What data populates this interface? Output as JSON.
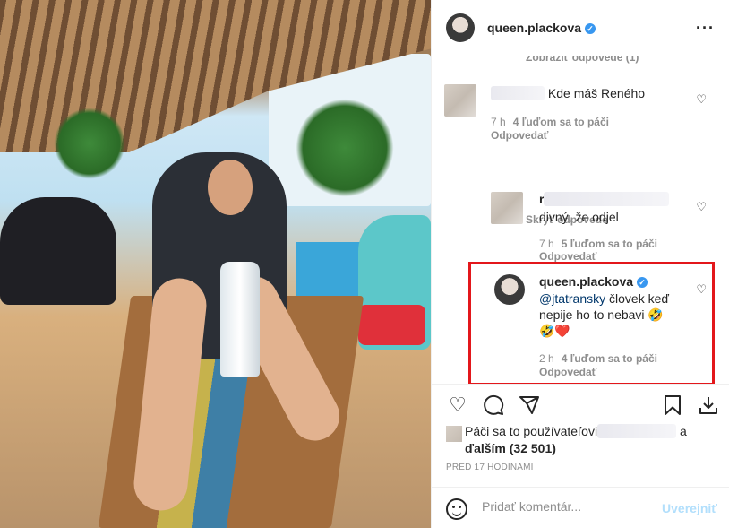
{
  "post": {
    "username": "queen.plackova",
    "more_icon": "more-icon"
  },
  "comments": {
    "truncated_label": "Zobraziť odpovede (1)",
    "hide_replies": "Skryť odpovede",
    "items": [
      {
        "text": "Kde máš Reného",
        "time": "7 h",
        "likes": "4 ľuďom sa to páči",
        "reply": "Odpovedať"
      },
      {
        "text": "divný, že odjel",
        "time": "7 h",
        "likes": "5 ľuďom sa to páči",
        "reply": "Odpovedať",
        "name_prefix": "r"
      },
      {
        "username": "queen.plackova",
        "mention": "@jtatransky",
        "text": " človek keď nepije ho to nebavi 🤣",
        "text2": "🤣❤️",
        "time": "2 h",
        "likes": "4 ľuďom sa to páči",
        "reply": "Odpovedať"
      }
    ]
  },
  "likes": {
    "prefix": "Páči sa to používateľovi",
    "suffix": " a",
    "others": "ďalším (32 501)"
  },
  "timestamp": "PRED 17 HODINAMI",
  "add_comment": {
    "placeholder": "Pridať komentár...",
    "post_label": "Uverejniť"
  },
  "colors": {
    "highlight": "#e3171b",
    "link": "#00376b",
    "post_button": "#b2dffc",
    "verified": "#3897f0"
  }
}
